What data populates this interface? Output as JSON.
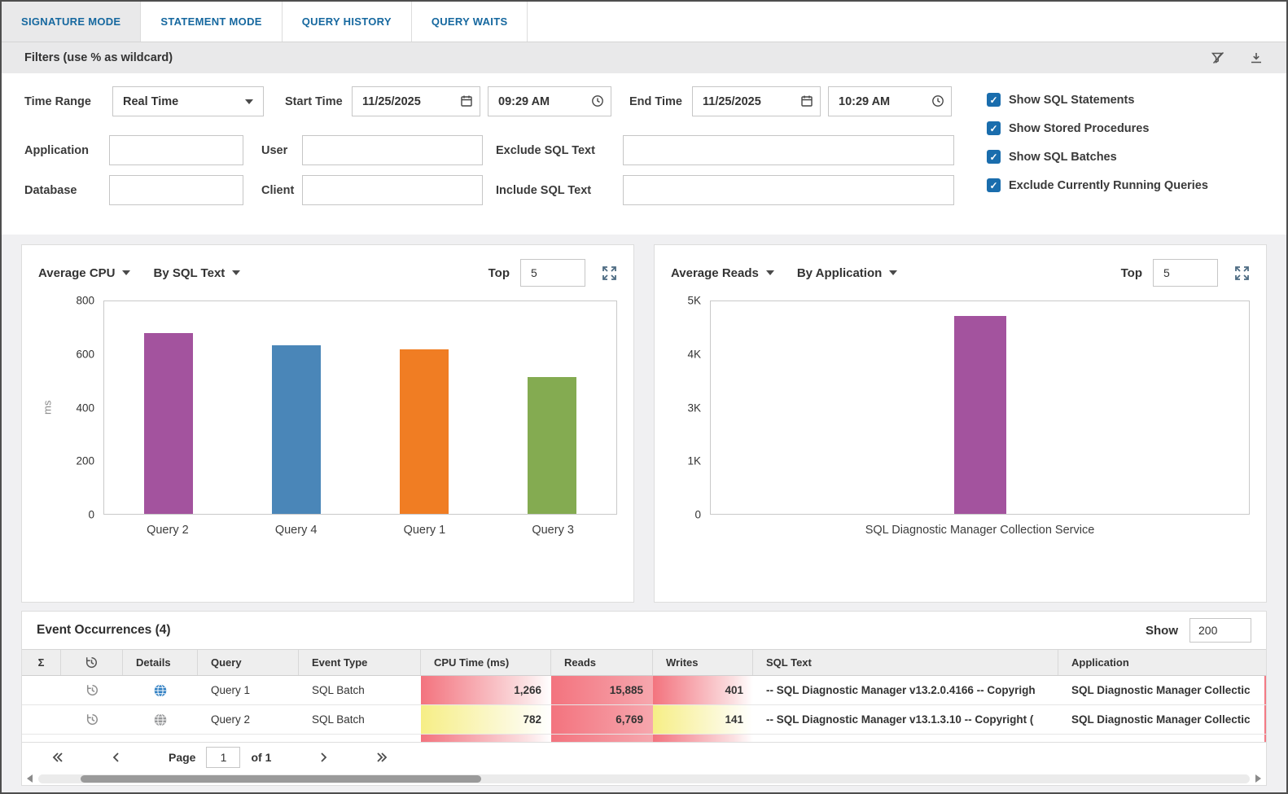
{
  "tabs": [
    {
      "label": "SIGNATURE MODE",
      "active": true
    },
    {
      "label": "STATEMENT MODE",
      "active": false
    },
    {
      "label": "QUERY HISTORY",
      "active": false
    },
    {
      "label": "QUERY WAITS",
      "active": false
    }
  ],
  "filters": {
    "title": "Filters (use % as wildcard)",
    "time_range_label": "Time Range",
    "time_range_value": "Real Time",
    "start_time_label": "Start Time",
    "start_date": "11/25/2025",
    "start_clock": "09:29 AM",
    "end_time_label": "End Time",
    "end_date": "11/25/2025",
    "end_clock": "10:29 AM",
    "fields": [
      {
        "label": "Application",
        "value": ""
      },
      {
        "label": "User",
        "value": ""
      },
      {
        "label": "Exclude SQL Text",
        "value": ""
      },
      {
        "label": "Database",
        "value": ""
      },
      {
        "label": "Client",
        "value": ""
      },
      {
        "label": "Include SQL Text",
        "value": ""
      }
    ],
    "checkboxes": [
      {
        "label": "Show SQL Statements",
        "checked": true
      },
      {
        "label": "Show Stored Procedures",
        "checked": true
      },
      {
        "label": "Show SQL Batches",
        "checked": true
      },
      {
        "label": "Exclude Currently Running Queries",
        "checked": true
      }
    ]
  },
  "chart_data": [
    {
      "type": "bar",
      "title": "Average CPU",
      "group_by": "By SQL Text",
      "top_label": "Top",
      "top_value": "5",
      "ylabel": "ms",
      "ylim": [
        0,
        800
      ],
      "yticks": [
        "800",
        "600",
        "400",
        "200",
        "0"
      ],
      "categories": [
        "Query 2",
        "Query 4",
        "Query 1",
        "Query 3"
      ],
      "values": [
        680,
        635,
        620,
        515
      ],
      "colors": [
        "#a3539e",
        "#4a86b8",
        "#f07d23",
        "#84ab51"
      ],
      "legend": false,
      "grid": false
    },
    {
      "type": "bar",
      "title": "Average Reads",
      "group_by": "By Application",
      "top_label": "Top",
      "top_value": "5",
      "ylabel": "",
      "ylim": [
        0,
        5000
      ],
      "yticks": [
        "5K",
        "4K",
        "3K",
        "1K",
        "0"
      ],
      "categories": [
        "SQL Diagnostic Manager Collection Service"
      ],
      "values": [
        4650
      ],
      "colors": [
        "#a3539e"
      ],
      "legend": false,
      "grid": false
    }
  ],
  "events": {
    "title": "Event Occurrences (4)",
    "show_label": "Show",
    "show_value": "200",
    "columns": [
      "Σ",
      "",
      "Details",
      "Query",
      "Event Type",
      "CPU Time (ms)",
      "Reads",
      "Writes",
      "SQL Text",
      "Application"
    ],
    "globe_colors": {
      "blue": "#2e7ec2",
      "gray": "#97989a"
    },
    "rows": [
      {
        "globe": "blue",
        "query": "Query 1",
        "event_type": "SQL Batch",
        "cpu": "1,266",
        "cpu_heat": "red",
        "reads": "15,885",
        "reads_heat": "red-strong",
        "writes": "401",
        "writes_heat": "red",
        "sql_text": "-- SQL Diagnostic Manager v13.2.0.4166 -- Copyrigh",
        "application": "SQL Diagnostic Manager Collectic"
      },
      {
        "globe": "gray",
        "query": "Query 2",
        "event_type": "SQL Batch",
        "cpu": "782",
        "cpu_heat": "yellow",
        "reads": "6,769",
        "reads_heat": "red-strong",
        "writes": "141",
        "writes_heat": "yellow",
        "sql_text": "-- SQL Diagnostic Manager v13.1.3.10 -- Copyright (",
        "application": "SQL Diagnostic Manager Collectic"
      },
      {
        "globe": "",
        "query": "",
        "event_type": "",
        "cpu": "",
        "cpu_heat": "red",
        "reads": "",
        "reads_heat": "red-strong",
        "writes": "",
        "writes_heat": "red",
        "sql_text": "",
        "application": ""
      }
    ]
  },
  "pagination": {
    "page_label": "Page",
    "page_value": "1",
    "of_label": "of 1"
  }
}
